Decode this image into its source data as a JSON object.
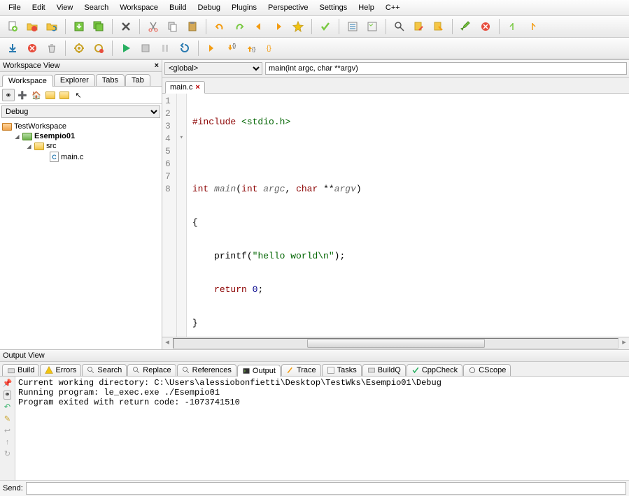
{
  "menu": [
    "File",
    "Edit",
    "View",
    "Search",
    "Workspace",
    "Build",
    "Debug",
    "Plugins",
    "Perspective",
    "Settings",
    "Help",
    "C++"
  ],
  "workspace": {
    "title": "Workspace View",
    "tabs": [
      "Workspace",
      "Explorer",
      "Tabs",
      "Tab"
    ],
    "config_label": "Debug",
    "tree": {
      "root": "TestWorkspace",
      "project": "Esempio01",
      "src": "src",
      "file": "main.c"
    }
  },
  "editor": {
    "scope": "<global>",
    "func": "main(int argc, char **argv)",
    "tab": "main.c",
    "lines": [
      "1",
      "2",
      "3",
      "4",
      "5",
      "6",
      "7",
      "8"
    ],
    "code": {
      "l1_a": "#include ",
      "l1_b": "<stdio.h>",
      "l3_a": "int",
      "l3_b": " main",
      "l3_c": "(",
      "l3_d": "int",
      "l3_e": " argc",
      "l3_f": ", ",
      "l3_g": "char",
      "l3_h": " **",
      "l3_i": "argv",
      "l3_j": ")",
      "l4": "{",
      "l5_a": "    printf(",
      "l5_b": "\"hello world\\n\"",
      "l5_c": ");",
      "l6_a": "    ",
      "l6_b": "return",
      "l6_c": " ",
      "l6_d": "0",
      "l6_e": ";",
      "l7": "}"
    }
  },
  "output": {
    "title": "Output View",
    "tabs": [
      "Build",
      "Errors",
      "Search",
      "Replace",
      "References",
      "Output",
      "Trace",
      "Tasks",
      "BuildQ",
      "CppCheck",
      "CScope"
    ],
    "lines": [
      "Current working directory: C:\\Users\\alessiobonfietti\\Desktop\\TestWks\\Esempio01\\Debug",
      "Running program: le_exec.exe ./Esempio01",
      "Program exited with return code: -1073741510"
    ],
    "send_label": "Send:"
  }
}
